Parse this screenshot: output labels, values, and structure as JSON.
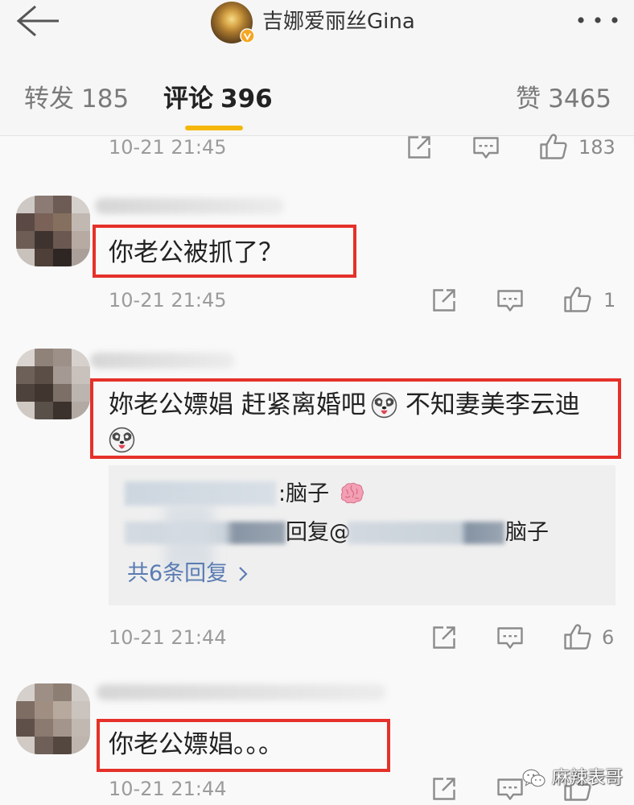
{
  "header": {
    "title": "吉娜爱丽丝Gina",
    "icons": {
      "back": "back-arrow-icon",
      "verified": "verified-badge-icon",
      "more": "more-dots-icon"
    }
  },
  "tabs": [
    {
      "label": "转发",
      "count": "185",
      "active": false
    },
    {
      "label": "评论",
      "count": "396",
      "active": true
    },
    {
      "label": "赞",
      "count": "3465",
      "active": false
    }
  ],
  "comments": [
    {
      "time": "10-21 21:45",
      "likes": "183"
    },
    {
      "text": "你老公被抓了？",
      "highlighted": true,
      "time": "10-21 21:45",
      "likes": "1"
    },
    {
      "text_parts": [
        "妳老公嫖娼 赶紧离婚吧",
        "不知妻美李云迪"
      ],
      "emoji": "husky-laugh-emoji",
      "highlighted": true,
      "replies": [
        {
          "text": ":脑子",
          "emoji": "brain-emoji"
        },
        {
          "reply_prefix": "回复@",
          "text": "脑子"
        }
      ],
      "more_replies": "共6条回复",
      "time": "10-21 21:44",
      "likes": "6"
    },
    {
      "text": "你老公嫖娼。。。",
      "highlighted": true,
      "time": "10-21 21:44"
    }
  ],
  "action_icons": [
    "share-icon",
    "comment-icon",
    "like-icon"
  ],
  "watermark": {
    "icon": "wechat-icon",
    "text": "麻辣表哥"
  },
  "colors": {
    "accent": "#f5b70b",
    "highlight": "#e5312a",
    "link": "#5b7cb3",
    "verified": "#f5a623",
    "timestamp": "#9b9b9b"
  }
}
